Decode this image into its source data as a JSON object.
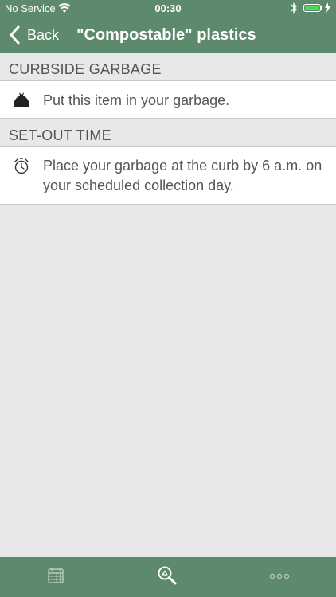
{
  "status_bar": {
    "carrier": "No Service",
    "time": "00:30"
  },
  "nav": {
    "back_label": "Back",
    "title": "\"Compostable\" plastics"
  },
  "sections": [
    {
      "header": "CURBSIDE GARBAGE",
      "icon": "garbage-bag-icon",
      "text": "Put this item in your garbage."
    },
    {
      "header": "SET-OUT TIME",
      "icon": "alarm-clock-icon",
      "text": "Place your garbage at the curb by 6 a.m. on your scheduled collection day."
    }
  ],
  "tabs": [
    {
      "icon": "calendar-icon"
    },
    {
      "icon": "recycle-search-icon"
    },
    {
      "icon": "more-icon"
    }
  ],
  "colors": {
    "bar": "#5d8a6c",
    "background": "#e8e8e8",
    "text": "#555555",
    "battery": "#4cd964"
  }
}
